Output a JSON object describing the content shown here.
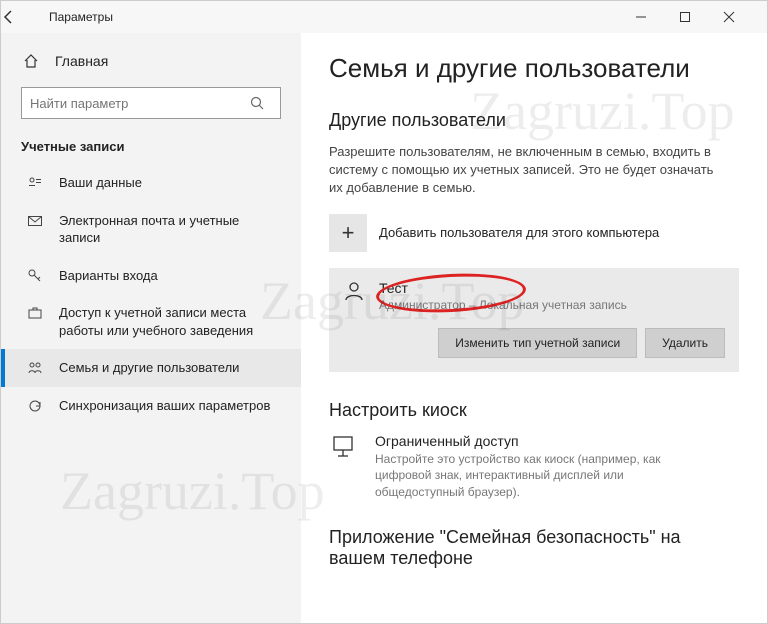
{
  "window": {
    "title": "Параметры"
  },
  "sidebar": {
    "home": "Главная",
    "search_placeholder": "Найти параметр",
    "section": "Учетные записи",
    "items": [
      {
        "label": "Ваши данные"
      },
      {
        "label": "Электронная почта и учетные записи"
      },
      {
        "label": "Варианты входа"
      },
      {
        "label": "Доступ к учетной записи места работы или учебного заведения"
      },
      {
        "label": "Семья и другие пользователи"
      },
      {
        "label": "Синхронизация ваших параметров"
      }
    ]
  },
  "content": {
    "title": "Семья и другие пользователи",
    "other_users_heading": "Другие пользователи",
    "other_users_desc": "Разрешите пользователям, не включенным в семью, входить в систему с помощью их учетных записей. Это не будет означать их добавление в семью.",
    "add_user_label": "Добавить пользователя для этого компьютера",
    "user": {
      "name": "Тест",
      "type": "Администратор – Локальная учетная запись",
      "change_btn": "Изменить тип учетной записи",
      "delete_btn": "Удалить"
    },
    "kiosk_heading": "Настроить киоск",
    "kiosk": {
      "title": "Ограниченный доступ",
      "desc": "Настройте это устройство как киоск (например, как цифровой знак, интерактивный дисплей или общедоступный браузер)."
    },
    "app_heading": "Приложение \"Семейная безопасность\" на вашем телефоне"
  },
  "watermark": "Zagruzi.Top"
}
